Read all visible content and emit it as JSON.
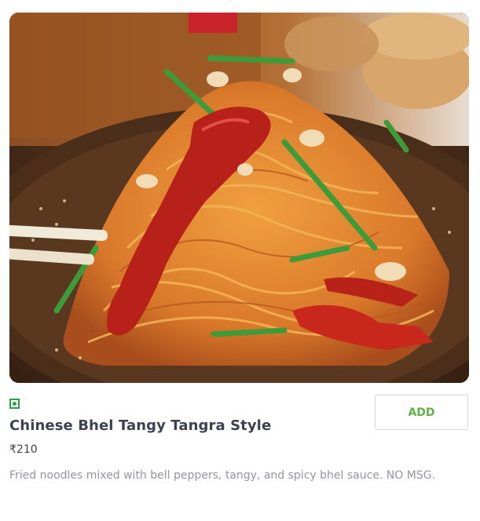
{
  "item": {
    "image_alt": "Chinese Bhel Tangy Tangra Style",
    "is_veg": true,
    "name": "Chinese Bhel Tangy Tangra Style",
    "price": "₹210",
    "description": "Fried noodles mixed with bell peppers, tangy, and spicy bhel sauce. NO MSG.",
    "add_label": "ADD"
  },
  "colors": {
    "veg_green": "#2e9e46",
    "add_green": "#60b246",
    "title": "#3d4152",
    "description": "#93959f"
  }
}
